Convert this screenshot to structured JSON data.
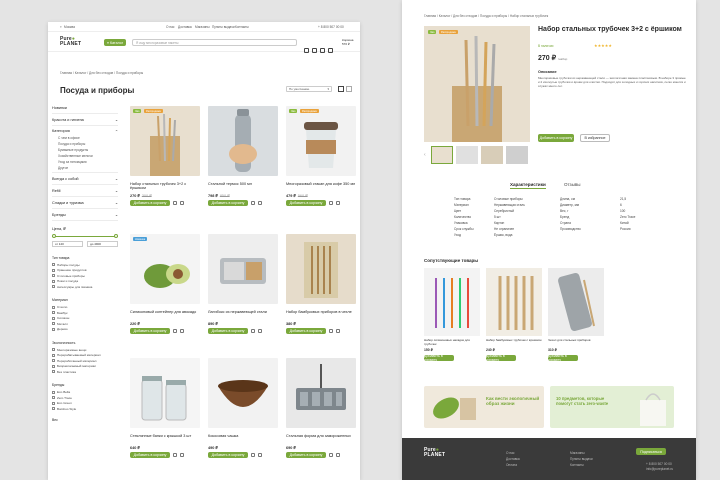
{
  "header": {
    "city": "Москва",
    "nav": [
      "О нас",
      "Доставка",
      "Магазины",
      "Пункты выдачи",
      "Контакты"
    ],
    "phone": "+ 8 800 507 00 00",
    "logo_line1": "Pure",
    "logo_line2": "PLANET",
    "catalog_button": "Каталог",
    "search_placeholder": "Я ищу многоразовые пакеты",
    "cart_label": "Корзина",
    "cart_sum": "570 ₽"
  },
  "breadcrumb": "Главная / Каталог / Для без отходов / Посуда и приборы",
  "page_title": "Посуда и приборы",
  "sort_label": "По умолчанию",
  "sidebar": {
    "top_items": [
      "Новинки",
      "Красота и гигиена"
    ],
    "category_header": "Категория",
    "category_subitems": [
      "С чем в офисе",
      "Посуда и приборы",
      "Бумажные продукты",
      "Хозяйственные мелочи",
      "Уход за питомцами",
      "Другое"
    ],
    "more_items": [
      "Всегда с собой",
      "Refill",
      "Сладки и туризма",
      "Бренды"
    ],
    "price_header": "Цена, ₽",
    "price_from": "от 120",
    "price_to": "до 4900",
    "types_header": "Тип товара",
    "types": [
      "Наборы посуды",
      "Хранение продуктов",
      "Столовые приборы",
      "Ножи и посуда",
      "Аксессуары для пикника"
    ],
    "material_header": "Материал",
    "materials": [
      "Стекло",
      "Бамбук",
      "Силикон",
      "Металл",
      "Дерево"
    ],
    "eco_header": "Экологичность",
    "eco": [
      "Многоразовые вещи",
      "Перерабатываемый материал",
      "Переработанный материал",
      "Биоразлагаемый материал",
      "Без пластика"
    ],
    "brands_header": "Бренды",
    "brands": [
      "Eco Bella",
      "Zero Trace",
      "Eco Green",
      "Bamboo Style"
    ],
    "weight_header": "Вес"
  },
  "products": [
    {
      "title": "Набор стальных трубочек 3+2 с ёршиком",
      "price": "270 ₽",
      "old_price": "300 ₽",
      "badges": [
        "Эко",
        "Распродажа"
      ],
      "button": "Добавить в корзину"
    },
    {
      "title": "Стальной термос 500 мл",
      "price": "798 ₽",
      "old_price": "850 ₽",
      "badges": [],
      "button": "Добавить в корзину"
    },
    {
      "title": "Многоразовый стакан для кофе 350 мл",
      "price": "479 ₽",
      "old_price": "560 ₽",
      "badges": [
        "Эко",
        "Распродажа"
      ],
      "button": "Добавить в корзину"
    },
    {
      "title": "Силиконовый контейнер для авокадо",
      "price": "220 ₽",
      "old_price": "",
      "badges": [
        "Новинка"
      ],
      "button": "Добавить в корзину"
    },
    {
      "title": "Ланчбокс из нержавеющей стали",
      "price": "890 ₽",
      "old_price": "",
      "badges": [],
      "button": "Добавить в корзину"
    },
    {
      "title": "Набор бамбуковых приборов в чехле",
      "price": "380 ₽",
      "old_price": "",
      "badges": [],
      "button": "Добавить в корзину"
    },
    {
      "title": "Стеклянные банки с крышкой 3 шт",
      "price": "640 ₽",
      "old_price": "",
      "badges": [],
      "button": "Добавить в корзину"
    },
    {
      "title": "Кокосовая чашка",
      "price": "490 ₽",
      "old_price": "",
      "badges": [],
      "button": "Добавить в корзину"
    },
    {
      "title": "Стальная форма для замороженных",
      "price": "690 ₽",
      "old_price": "",
      "badges": [],
      "button": "Добавить в корзину"
    }
  ],
  "detail": {
    "breadcrumb": "Главная / Каталог / Для без отходов / Посуда и приборы / Набор стальных трубочек",
    "title": "Набор стальных трубочек 3+2 с ёршиком",
    "stock": "В наличии",
    "rating": "★★★★★",
    "price": "270 ₽",
    "unit": "/набор",
    "desc_header": "Описание",
    "desc": "Многоразовые трубочки из нержавеющей стали — экологичная замена пластиковым. В наборе 3 прямые и 2 изогнутые трубочки и ёршик для очистки. Подходят для холодных и горячих напитков, легко моются и служат много лет.",
    "add_button": "Добавить в корзину",
    "fav_button": "В избранное",
    "tabs": [
      "Характеристики",
      "Отзывы"
    ],
    "specs_left": [
      [
        "Тип товара",
        "Столовые приборы"
      ],
      [
        "Материал",
        "Нержавеющая сталь"
      ],
      [
        "Цвет",
        "Серебристый"
      ],
      [
        "Количество",
        "5 шт"
      ],
      [
        "Упаковка",
        "Картон"
      ],
      [
        "Срок службы",
        "Не ограничен"
      ],
      [
        "Уход",
        "Ёршик, вода"
      ]
    ],
    "specs_right": [
      [
        "Длина, см",
        "21,5"
      ],
      [
        "Диаметр, мм",
        "6"
      ],
      [
        "Вес, г",
        "100"
      ],
      [
        "Бренд",
        "Zero Trace"
      ],
      [
        "Страна",
        "Китай"
      ],
      [
        "Производство",
        "Россия"
      ]
    ],
    "related_header": "Сопутствующие товары",
    "related": [
      {
        "title": "Набор силиконовых насадок для трубочек",
        "price": "150 ₽",
        "button": "Добавить в корзину"
      },
      {
        "title": "Набор бамбуковых трубочек с ёршиком",
        "price": "240 ₽",
        "button": "Добавить в корзину"
      },
      {
        "title": "Чехол для стальных приборов",
        "price": "310 ₽",
        "button": "Добавить в корзину"
      }
    ],
    "banner1": "Как вести экологичный образ жизни",
    "banner2": "10 предметов, которые помогут стать zero-waste"
  },
  "footer": {
    "logo_line1": "Pure",
    "logo_line2": "PLANET",
    "col1": [
      "О нас",
      "Доставка",
      "Оплата"
    ],
    "col2": [
      "Магазины",
      "Пункты выдачи",
      "Контакты"
    ],
    "subscribe_button": "Подписаться",
    "phone": "+ 8 800 507 00 00",
    "email": "info@pureplanet.ru"
  },
  "colors": {
    "accent": "#7aa83b",
    "badge_eco": "#8bbb3f",
    "badge_sale": "#e9a23b",
    "badge_new": "#4a9fd8",
    "footer": "#3a3a3a"
  }
}
